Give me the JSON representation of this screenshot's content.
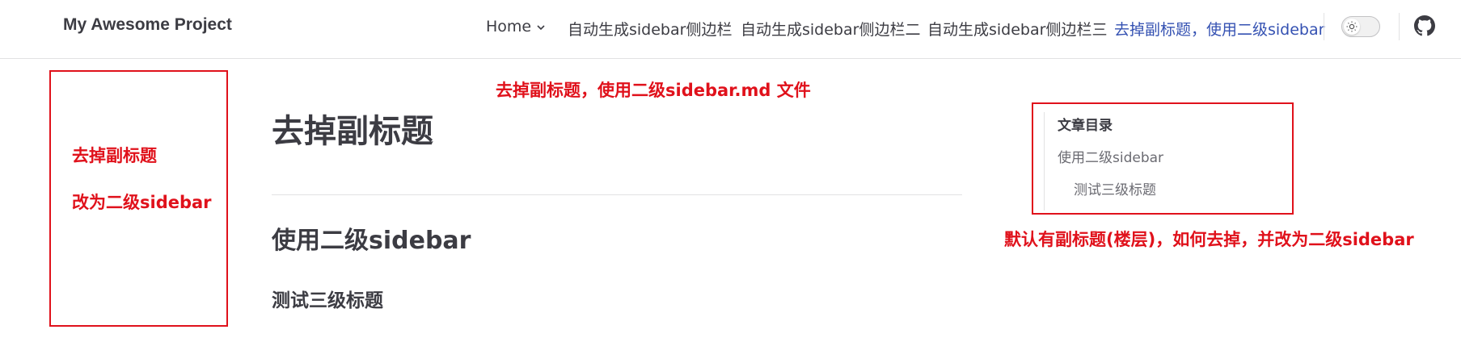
{
  "nav": {
    "site_title": "My Awesome Project",
    "items": [
      {
        "label": "Home"
      },
      {
        "label": "自动生成sidebar侧边栏"
      },
      {
        "label": "自动生成sidebar侧边栏二"
      },
      {
        "label": "自动生成sidebar侧边栏三"
      },
      {
        "label": "去掉副标题，使用二级sidebar"
      }
    ],
    "active_color": "#3451b2"
  },
  "icons": [
    "chevron-down-icon",
    "sun-icon",
    "github-icon"
  ],
  "annotations": {
    "top": "去掉副标题，使用二级sidebar.md 文件",
    "left_line1": "去掉副标题",
    "left_line2": "改为二级sidebar",
    "right": "默认有副标题(楼层)，如何去掉，并改为二级sidebar",
    "color": "#e0111b"
  },
  "content": {
    "h1": "去掉副标题",
    "h2": "使用二级sidebar",
    "h3": "测试三级标题"
  },
  "outline": {
    "title": "文章目录",
    "items": [
      {
        "label": "使用二级sidebar"
      },
      {
        "label": "测试三级标题"
      }
    ]
  }
}
